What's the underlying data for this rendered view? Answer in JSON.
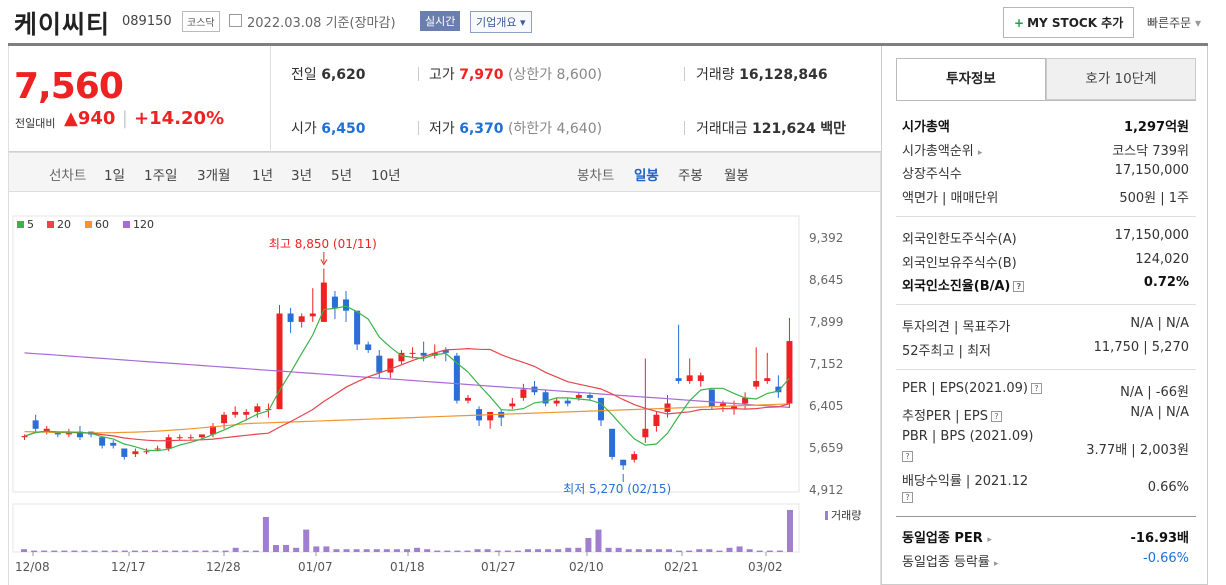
{
  "header": {
    "name": "케이씨티",
    "code": "089150",
    "market": "코스닥",
    "date": "2022.03.08",
    "basis": "기준(장마감)",
    "realtime": "실시간",
    "company_info": "기업개요",
    "my_stock": "MY STOCK 추가",
    "quick_order": "빠른주문"
  },
  "price": {
    "current": "7,560",
    "change_label": "전일대비",
    "change": "940",
    "change_pct": "+14.20%"
  },
  "stats": {
    "prev_label": "전일",
    "prev": "6,620",
    "high_label": "고가",
    "high": "7,970",
    "upper_limit": "(상한가 8,600)",
    "volume_label": "거래량",
    "volume": "16,128,846",
    "open_label": "시가",
    "open": "6,450",
    "low_label": "저가",
    "low": "6,370",
    "lower_limit": "(하한가 4,640)",
    "amount_label": "거래대금",
    "amount": "121,624",
    "amount_unit": "백만"
  },
  "controls": {
    "line_chart": "선차트",
    "periods": [
      "1일",
      "1주일",
      "3개월",
      "1년",
      "3년",
      "5년",
      "10년"
    ],
    "candle_chart": "봉차트",
    "candles": [
      "일봉",
      "주봉",
      "월봉"
    ],
    "active_candle": "일봉"
  },
  "chart_data": {
    "type": "candlestick",
    "ma_legend": [
      {
        "name": "5",
        "color": "#3cb34a"
      },
      {
        "name": "20",
        "color": "#e8454b"
      },
      {
        "name": "60",
        "color": "#f0962e"
      },
      {
        "name": "120",
        "color": "#a96ad8"
      }
    ],
    "y_ticks": [
      "9,392",
      "8,645",
      "7,899",
      "7,152",
      "6,405",
      "5,659",
      "4,912"
    ],
    "y_range": [
      4912,
      9392
    ],
    "x_ticks": [
      "12/08",
      "12/17",
      "12/28",
      "01/07",
      "01/18",
      "01/27",
      "02/10",
      "02/21",
      "03/02"
    ],
    "high_annotation": "최고 8,850 (01/11)",
    "low_annotation": "최저 5,270 (02/15)",
    "volume_label": "거래량",
    "candles": [
      [
        5850,
        5900,
        5800,
        5870
      ],
      [
        6150,
        6250,
        5950,
        6000
      ],
      [
        5950,
        6050,
        5900,
        6000
      ],
      [
        5950,
        5950,
        5850,
        5900
      ],
      [
        5900,
        6000,
        5850,
        5950
      ],
      [
        5950,
        6050,
        5800,
        5850
      ],
      [
        5950,
        5950,
        5850,
        5900
      ],
      [
        5850,
        5850,
        5650,
        5700
      ],
      [
        5750,
        5800,
        5650,
        5700
      ],
      [
        5650,
        5650,
        5450,
        5500
      ],
      [
        5550,
        5650,
        5500,
        5600
      ],
      [
        5600,
        5650,
        5550,
        5600
      ],
      [
        5650,
        5700,
        5600,
        5650
      ],
      [
        5650,
        5900,
        5600,
        5850
      ],
      [
        5850,
        5900,
        5800,
        5850
      ],
      [
        5850,
        5900,
        5800,
        5850
      ],
      [
        5850,
        5900,
        5800,
        5900
      ],
      [
        5900,
        6100,
        5850,
        6050
      ],
      [
        6100,
        6300,
        6000,
        6250
      ],
      [
        6250,
        6400,
        6200,
        6300
      ],
      [
        6250,
        6350,
        6150,
        6300
      ],
      [
        6300,
        6450,
        6200,
        6400
      ],
      [
        6350,
        6450,
        6200,
        6350
      ],
      [
        6350,
        8200,
        6350,
        8050
      ],
      [
        8050,
        8150,
        7700,
        7900
      ],
      [
        7900,
        8050,
        7800,
        8000
      ],
      [
        8000,
        8500,
        7900,
        8050
      ],
      [
        7900,
        8850,
        7900,
        8600
      ],
      [
        8350,
        8450,
        7950,
        8150
      ],
      [
        8300,
        8450,
        7900,
        8100
      ],
      [
        8100,
        8100,
        7400,
        7500
      ],
      [
        7500,
        7550,
        7350,
        7400
      ],
      [
        7300,
        7400,
        6900,
        7000
      ],
      [
        7000,
        7250,
        6900,
        7250
      ],
      [
        7200,
        7400,
        7150,
        7350
      ],
      [
        7350,
        7450,
        7250,
        7350
      ],
      [
        7350,
        7550,
        7200,
        7300
      ],
      [
        7300,
        7500,
        7250,
        7350
      ],
      [
        7400,
        7450,
        7200,
        7350
      ],
      [
        7300,
        7350,
        6450,
        6500
      ],
      [
        6500,
        6600,
        6450,
        6550
      ],
      [
        6350,
        6400,
        6050,
        6150
      ],
      [
        6150,
        6300,
        6000,
        6300
      ],
      [
        6300,
        6350,
        6050,
        6200
      ],
      [
        6400,
        6550,
        6350,
        6450
      ],
      [
        6550,
        6800,
        6500,
        6700
      ],
      [
        6750,
        6850,
        6600,
        6650
      ],
      [
        6650,
        6700,
        6400,
        6450
      ],
      [
        6450,
        6550,
        6400,
        6500
      ],
      [
        6500,
        6550,
        6400,
        6450
      ],
      [
        6550,
        6650,
        6500,
        6600
      ],
      [
        6600,
        6650,
        6500,
        6550
      ],
      [
        6550,
        6550,
        6050,
        6150
      ],
      [
        6000,
        6000,
        5450,
        5500
      ],
      [
        5450,
        5450,
        5270,
        5350
      ],
      [
        5450,
        5600,
        5400,
        5550
      ],
      [
        5850,
        7250,
        5750,
        6000
      ],
      [
        6050,
        6300,
        5950,
        6250
      ],
      [
        6300,
        6600,
        6200,
        6450
      ],
      [
        6900,
        7850,
        6800,
        6850
      ],
      [
        6850,
        7250,
        6800,
        6950
      ],
      [
        6850,
        7000,
        6750,
        6950
      ],
      [
        6700,
        6700,
        6350,
        6400
      ],
      [
        6400,
        6500,
        6300,
        6450
      ],
      [
        6350,
        6500,
        6250,
        6400
      ],
      [
        6450,
        6650,
        6350,
        6550
      ],
      [
        6750,
        7450,
        6700,
        6850
      ],
      [
        6850,
        7350,
        6800,
        6900
      ],
      [
        6750,
        6950,
        6550,
        6650
      ],
      [
        6450,
        7970,
        6370,
        7560
      ]
    ],
    "volume": [
      2,
      1,
      1,
      1,
      1,
      1,
      1,
      1,
      1,
      1,
      1,
      1,
      1,
      1,
      1,
      1,
      1,
      1,
      1,
      1,
      1,
      3,
      1,
      1,
      25,
      5,
      5,
      3,
      16,
      4,
      4,
      2,
      2,
      2,
      2,
      2,
      2,
      2,
      2,
      3,
      2,
      1,
      1,
      1,
      1,
      2,
      2,
      1,
      1,
      1,
      2,
      2,
      2,
      2,
      3,
      3,
      10,
      16,
      3,
      3,
      2,
      2,
      2,
      2,
      2,
      1,
      1,
      2,
      2,
      1,
      3,
      4,
      2,
      1,
      1,
      1,
      30
    ]
  },
  "invest": {
    "tabs": [
      "투자정보",
      "호가 10단계"
    ],
    "rows1": [
      {
        "label": "시가총액",
        "value": "1,297억원",
        "bold": true
      },
      {
        "label": "시가총액순위",
        "value": "코스닥 739위"
      },
      {
        "label": "상장주식수",
        "value": "17,150,000"
      },
      {
        "label": "액면가 | 매매단위",
        "value": "500원 | 1주"
      }
    ],
    "rows2": [
      {
        "label": "외국인한도주식수(A)",
        "value": "17,150,000"
      },
      {
        "label": "외국인보유주식수(B)",
        "value": "124,020"
      },
      {
        "label": "외국인소진율(B/A)",
        "value": "0.72%",
        "bold": true
      }
    ],
    "rows3": [
      {
        "label": "투자의견 | 목표주가",
        "value": "N/A | N/A"
      },
      {
        "label": "52주최고 | 최저",
        "value": "11,750 | 5,270"
      }
    ],
    "rows4": [
      {
        "label": "PER | EPS(2021.09)",
        "value": "N/A | -66원"
      },
      {
        "label": "추정PER | EPS",
        "value": "N/A | N/A"
      },
      {
        "label": "PBR | BPS (2021.09)",
        "value": "3.77배 | 2,003원"
      },
      {
        "label": "배당수익률 | 2021.12",
        "value": "0.66%"
      }
    ],
    "rows5": [
      {
        "label": "동일업종 PER",
        "value": "-16.93배"
      },
      {
        "label": "동일업종 등락률",
        "value": "-0.66%"
      }
    ]
  }
}
